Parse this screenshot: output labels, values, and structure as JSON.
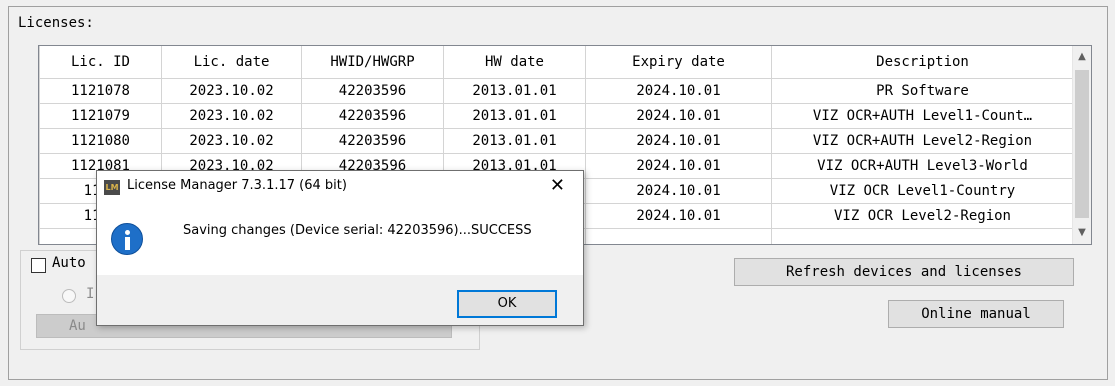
{
  "licenses": {
    "group_label": "Licenses:",
    "columns": [
      "Lic. ID",
      "Lic. date",
      "HWID/HWGRP",
      "HW date",
      "Expiry date",
      "Description"
    ],
    "rows": [
      {
        "id": "1121078",
        "lic_date": "2023.10.02",
        "hwid": "42203596",
        "hw_date": "2013.01.01",
        "expiry": "2024.10.01",
        "desc": "PR Software"
      },
      {
        "id": "1121079",
        "lic_date": "2023.10.02",
        "hwid": "42203596",
        "hw_date": "2013.01.01",
        "expiry": "2024.10.01",
        "desc": "VIZ OCR+AUTH Level1-Count…"
      },
      {
        "id": "1121080",
        "lic_date": "2023.10.02",
        "hwid": "42203596",
        "hw_date": "2013.01.01",
        "expiry": "2024.10.01",
        "desc": "VIZ OCR+AUTH Level2-Region"
      },
      {
        "id": "1121081",
        "lic_date": "2023.10.02",
        "hwid": "42203596",
        "hw_date": "2013.01.01",
        "expiry": "2024.10.01",
        "desc": "VIZ OCR+AUTH Level3-World"
      },
      {
        "id": "1121",
        "lic_date": "",
        "hwid": "",
        "hw_date": "",
        "expiry": "2024.10.01",
        "desc": "VIZ OCR Level1-Country"
      },
      {
        "id": "1121",
        "lic_date": "",
        "hwid": "",
        "hw_date": "",
        "expiry": "2024.10.01",
        "desc": "VIZ OCR Level2-Region"
      },
      {
        "id": "",
        "lic_date": "",
        "hwid": "",
        "hw_date": "",
        "expiry": "",
        "desc": ""
      }
    ]
  },
  "auto": {
    "checkbox_label": "Auto",
    "radio_label": "I",
    "button_label": "Au"
  },
  "buttons": {
    "refresh": "Refresh devices and licenses",
    "manual": "Online manual"
  },
  "dialog": {
    "icon_text": "LM",
    "title": "License Manager 7.3.1.17 (64 bit)",
    "close": "✕",
    "message": "Saving changes (Device serial: 42203596)...SUCCESS",
    "ok": "OK"
  },
  "icons": {
    "scroll_up": "chevron-up-icon",
    "scroll_down": "chevron-down-icon",
    "info": "info-icon",
    "app": "app-logo-icon"
  },
  "colors": {
    "accent": "#0078d7",
    "info_blue": "#1e6fc8"
  }
}
